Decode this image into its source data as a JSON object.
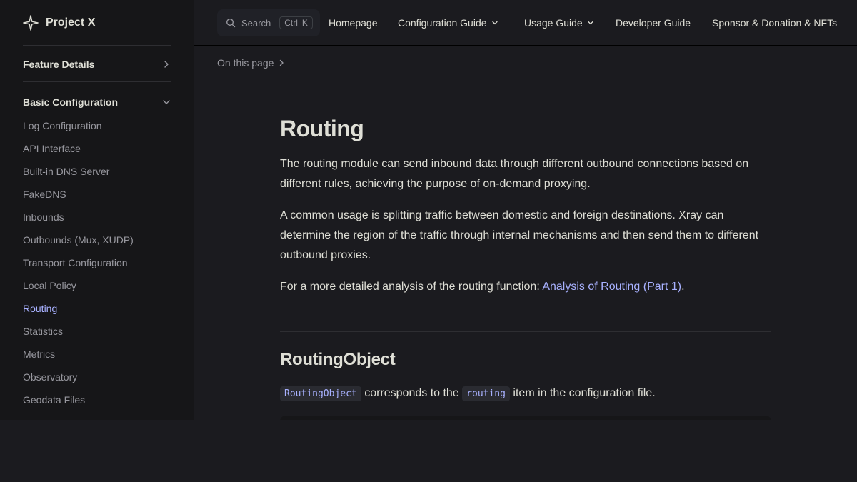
{
  "brand": {
    "title": "Project X"
  },
  "search": {
    "label": "Search",
    "kbd_ctrl": "Ctrl",
    "kbd_key": "K"
  },
  "nav": {
    "homepage": "Homepage",
    "config_guide": "Configuration Guide",
    "usage_guide": "Usage Guide",
    "developer_guide": "Developer Guide",
    "sponsor": "Sponsor & Donation & NFTs"
  },
  "sidebar": {
    "section1": "Feature Details",
    "section2": "Basic Configuration",
    "items": [
      "Log Configuration",
      "API Interface",
      "Built-in DNS Server",
      "FakeDNS",
      "Inbounds",
      "Outbounds (Mux, XUDP)",
      "Transport Configuration",
      "Local Policy",
      "Routing",
      "Statistics",
      "Metrics",
      "Observatory",
      "Geodata Files"
    ],
    "active_item": "Routing"
  },
  "localnav": {
    "on_this_page": "On this page"
  },
  "content": {
    "title": "Routing",
    "p1": "The routing module can send inbound data through different outbound connections based on different rules, achieving the purpose of on-demand proxying.",
    "p2": "A common usage is splitting traffic between domestic and foreign destinations. Xray can determine the region of the traffic through internal mechanisms and then send them to different outbound proxies.",
    "p3_prefix": "For a more detailed analysis of the routing function: ",
    "p3_link": "Analysis of Routing (Part 1)",
    "p3_suffix": ".",
    "h2": "RoutingObject",
    "p4_code1": "RoutingObject",
    "p4_mid": " corresponds to the ",
    "p4_code2": "routing",
    "p4_suffix": " item in the configuration file."
  },
  "colors": {
    "background": "#1b1b1f",
    "sidebar": "#161618",
    "accent": "#a8b1ff",
    "text": "#dfdfd6",
    "muted": "#98989f"
  }
}
